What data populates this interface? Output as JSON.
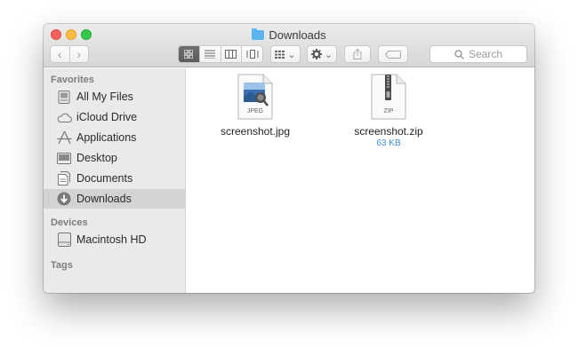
{
  "window": {
    "title": "Downloads"
  },
  "toolbar": {
    "back_label": "‹",
    "forward_label": "›",
    "arrange_caret": "⌄",
    "action_caret": "⌄",
    "search_placeholder": "Search"
  },
  "sidebar": {
    "favorites_title": "Favorites",
    "favorites": [
      {
        "label": "All My Files",
        "icon": "all-files-icon"
      },
      {
        "label": "iCloud Drive",
        "icon": "cloud-icon"
      },
      {
        "label": "Applications",
        "icon": "applications-icon"
      },
      {
        "label": "Desktop",
        "icon": "desktop-icon"
      },
      {
        "label": "Documents",
        "icon": "documents-icon"
      },
      {
        "label": "Downloads",
        "icon": "downloads-icon",
        "selected": true
      }
    ],
    "devices_title": "Devices",
    "devices": [
      {
        "label": "Macintosh HD",
        "icon": "hard-drive-icon"
      }
    ],
    "tags_title": "Tags"
  },
  "files": [
    {
      "name": "screenshot.jpg",
      "badge": "JPEG",
      "size": ""
    },
    {
      "name": "screenshot.zip",
      "badge": "ZIP",
      "size": "63 KB"
    }
  ],
  "colors": {
    "selected_row": "#d3d3d3",
    "size_text": "#3d8fe0",
    "folder_blue": "#5ab4ee"
  }
}
